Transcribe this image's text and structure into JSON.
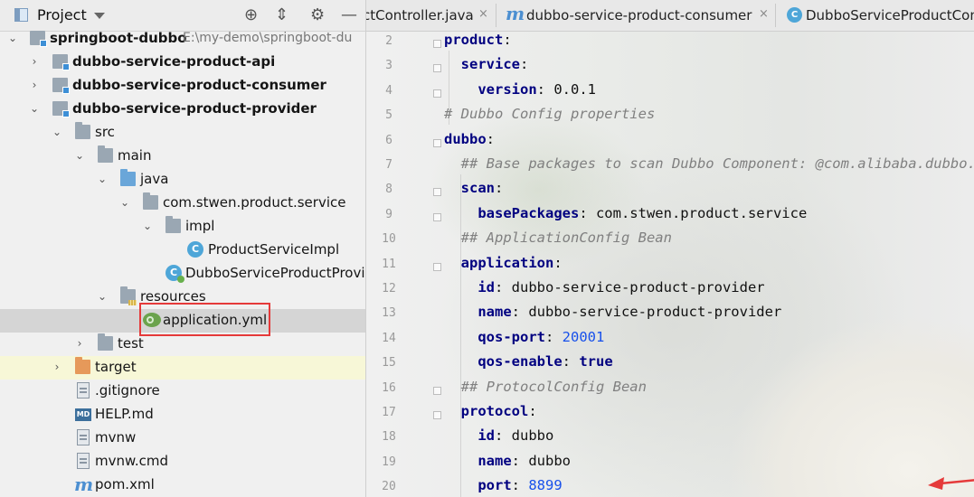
{
  "project_panel": {
    "title": "Project",
    "header_icons": [
      "crosshair-icon",
      "collapse-all-icon",
      "settings-icon",
      "hide-icon"
    ],
    "tree": [
      {
        "label": "springboot-dubbo",
        "hint": "E:\\my-demo\\springboot-du",
        "icon": "module-folder-icon",
        "expanded": true
      },
      {
        "label": "dubbo-service-product-api",
        "icon": "module-folder-icon",
        "expanded": false
      },
      {
        "label": "dubbo-service-product-consumer",
        "icon": "module-folder-icon",
        "expanded": false
      },
      {
        "label": "dubbo-service-product-provider",
        "icon": "module-folder-icon",
        "expanded": true
      },
      {
        "label": "src",
        "icon": "folder-icon",
        "expanded": true
      },
      {
        "label": "main",
        "icon": "folder-icon",
        "expanded": true
      },
      {
        "label": "java",
        "icon": "source-folder-icon",
        "expanded": true
      },
      {
        "label": "com.stwen.product.service",
        "icon": "package-icon",
        "expanded": true
      },
      {
        "label": "impl",
        "icon": "package-icon",
        "expanded": true
      },
      {
        "label": "ProductServiceImpl",
        "icon": "class-icon"
      },
      {
        "label": "DubboServiceProductProvi",
        "icon": "spring-boot-class-icon"
      },
      {
        "label": "resources",
        "icon": "resources-folder-icon",
        "expanded": true
      },
      {
        "label": "application.yml",
        "icon": "yaml-file-icon",
        "selected": true
      },
      {
        "label": "test",
        "icon": "folder-icon",
        "expanded": false
      },
      {
        "label": "target",
        "icon": "excluded-folder-icon",
        "expanded": false
      },
      {
        "label": ".gitignore",
        "icon": "text-file-icon"
      },
      {
        "label": "HELP.md",
        "icon": "markdown-file-icon",
        "badge": "MD"
      },
      {
        "label": "mvnw",
        "icon": "text-file-icon"
      },
      {
        "label": "mvnw.cmd",
        "icon": "text-file-icon"
      },
      {
        "label": "pom.xml",
        "icon": "maven-file-icon",
        "badge": "m"
      }
    ]
  },
  "editor": {
    "tabs": [
      {
        "label": "ctController.java",
        "close": "×"
      },
      {
        "label": "dubbo-service-product-consumer",
        "close": "×",
        "badge": "m"
      },
      {
        "label": "DubboServiceProductCon",
        "badge": "C"
      }
    ],
    "lines": [
      {
        "num": "2",
        "parts": [
          {
            "t": "k",
            "s": "product"
          },
          {
            "t": "v",
            "s": ":"
          }
        ]
      },
      {
        "num": "3",
        "parts": [
          {
            "t": "v",
            "s": "  "
          },
          {
            "t": "k",
            "s": "service"
          },
          {
            "t": "v",
            "s": ":"
          }
        ]
      },
      {
        "num": "4",
        "parts": [
          {
            "t": "v",
            "s": "    "
          },
          {
            "t": "k",
            "s": "version"
          },
          {
            "t": "v",
            "s": ": 0.0.1"
          }
        ]
      },
      {
        "num": "5",
        "parts": [
          {
            "t": "c",
            "s": "# Dubbo Config properties"
          }
        ]
      },
      {
        "num": "6",
        "parts": [
          {
            "t": "k",
            "s": "dubbo"
          },
          {
            "t": "v",
            "s": ":"
          }
        ]
      },
      {
        "num": "7",
        "parts": [
          {
            "t": "v",
            "s": "  "
          },
          {
            "t": "c",
            "s": "## Base packages to scan Dubbo Component: @com.alibaba.dubbo.co"
          }
        ]
      },
      {
        "num": "8",
        "parts": [
          {
            "t": "v",
            "s": "  "
          },
          {
            "t": "k",
            "s": "scan"
          },
          {
            "t": "v",
            "s": ":"
          }
        ]
      },
      {
        "num": "9",
        "parts": [
          {
            "t": "v",
            "s": "    "
          },
          {
            "t": "k",
            "s": "basePackages"
          },
          {
            "t": "v",
            "s": ": com.stwen.product.service"
          }
        ]
      },
      {
        "num": "10",
        "parts": [
          {
            "t": "v",
            "s": "  "
          },
          {
            "t": "c",
            "s": "## ApplicationConfig Bean"
          }
        ]
      },
      {
        "num": "11",
        "parts": [
          {
            "t": "v",
            "s": "  "
          },
          {
            "t": "k",
            "s": "application"
          },
          {
            "t": "v",
            "s": ":"
          }
        ]
      },
      {
        "num": "12",
        "parts": [
          {
            "t": "v",
            "s": "    "
          },
          {
            "t": "k",
            "s": "id"
          },
          {
            "t": "v",
            "s": ": dubbo-service-product-provider"
          }
        ]
      },
      {
        "num": "13",
        "parts": [
          {
            "t": "v",
            "s": "    "
          },
          {
            "t": "k",
            "s": "name"
          },
          {
            "t": "v",
            "s": ": dubbo-service-product-provider"
          }
        ]
      },
      {
        "num": "14",
        "parts": [
          {
            "t": "v",
            "s": "    "
          },
          {
            "t": "k",
            "s": "qos-port"
          },
          {
            "t": "v",
            "s": ": "
          },
          {
            "t": "n",
            "s": "20001"
          }
        ]
      },
      {
        "num": "15",
        "parts": [
          {
            "t": "v",
            "s": "    "
          },
          {
            "t": "k",
            "s": "qos-enable"
          },
          {
            "t": "v",
            "s": ": "
          },
          {
            "t": "k",
            "s": "true"
          }
        ]
      },
      {
        "num": "16",
        "parts": [
          {
            "t": "v",
            "s": "  "
          },
          {
            "t": "c",
            "s": "## ProtocolConfig Bean"
          }
        ]
      },
      {
        "num": "17",
        "parts": [
          {
            "t": "v",
            "s": "  "
          },
          {
            "t": "k",
            "s": "protocol"
          },
          {
            "t": "v",
            "s": ":"
          }
        ]
      },
      {
        "num": "18",
        "parts": [
          {
            "t": "v",
            "s": "    "
          },
          {
            "t": "k",
            "s": "id"
          },
          {
            "t": "v",
            "s": ": dubbo"
          }
        ]
      },
      {
        "num": "19",
        "parts": [
          {
            "t": "v",
            "s": "    "
          },
          {
            "t": "k",
            "s": "name"
          },
          {
            "t": "v",
            "s": ": dubbo"
          }
        ]
      },
      {
        "num": "20",
        "parts": [
          {
            "t": "v",
            "s": "    "
          },
          {
            "t": "k",
            "s": "port"
          },
          {
            "t": "v",
            "s": ": "
          },
          {
            "t": "n",
            "s": "8899"
          }
        ]
      }
    ]
  },
  "colors": {
    "highlight_box": "#e53a3a",
    "pointer_arrow": "#e53a3a",
    "yaml_key": "#000080",
    "number": "#1750eb",
    "comment": "#808080"
  }
}
